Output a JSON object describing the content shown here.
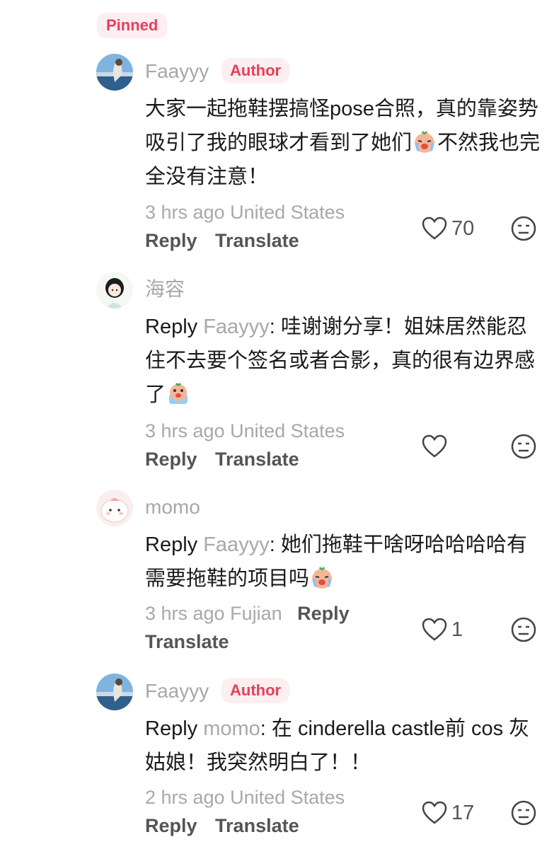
{
  "pinned_label": "Pinned",
  "colors": {
    "accent": "#e4405b",
    "badge_bg": "#fdeef0",
    "muted": "#a8a8a8"
  },
  "comments": [
    {
      "author": "Faayyy",
      "badge": "Author",
      "text": "大家一起拖鞋摆搞怪pose合照，真的靠姿势吸引了我的眼球才看到了她们",
      "text_after_emoji": "不然我也完全没有注意！",
      "emoji": "crying-face-icon",
      "time_location": "3 hrs ago United States",
      "reply_label": "Reply",
      "translate_label": "Translate",
      "likes": "70"
    },
    {
      "author": "海容",
      "reply_prefix": "Reply",
      "reply_to": "Faayyy",
      "text": ": 哇谢谢分享！姐妹居然能忍住不去要个签名或者合影，真的很有边界感了",
      "emoji": "crying-face-icon",
      "time_location": "3 hrs ago United States",
      "reply_label": "Reply",
      "translate_label": "Translate",
      "likes": ""
    },
    {
      "author": "momo",
      "reply_prefix": "Reply",
      "reply_to": "Faayyy",
      "text": ": 她们拖鞋干啥呀哈哈哈哈有需要拖鞋的项目吗",
      "emoji": "crying-face-icon",
      "time_location": "3 hrs ago Fujian",
      "reply_label": "Reply",
      "translate_label": "Translate",
      "likes": "1"
    },
    {
      "author": "Faayyy",
      "badge": "Author",
      "reply_prefix": "Reply",
      "reply_to": "momo",
      "text": ": 在 cinderella castle前 cos 灰姑娘！我突然明白了！！",
      "time_location": "2 hrs ago United States",
      "reply_label": "Reply",
      "translate_label": "Translate",
      "likes": "17"
    }
  ]
}
